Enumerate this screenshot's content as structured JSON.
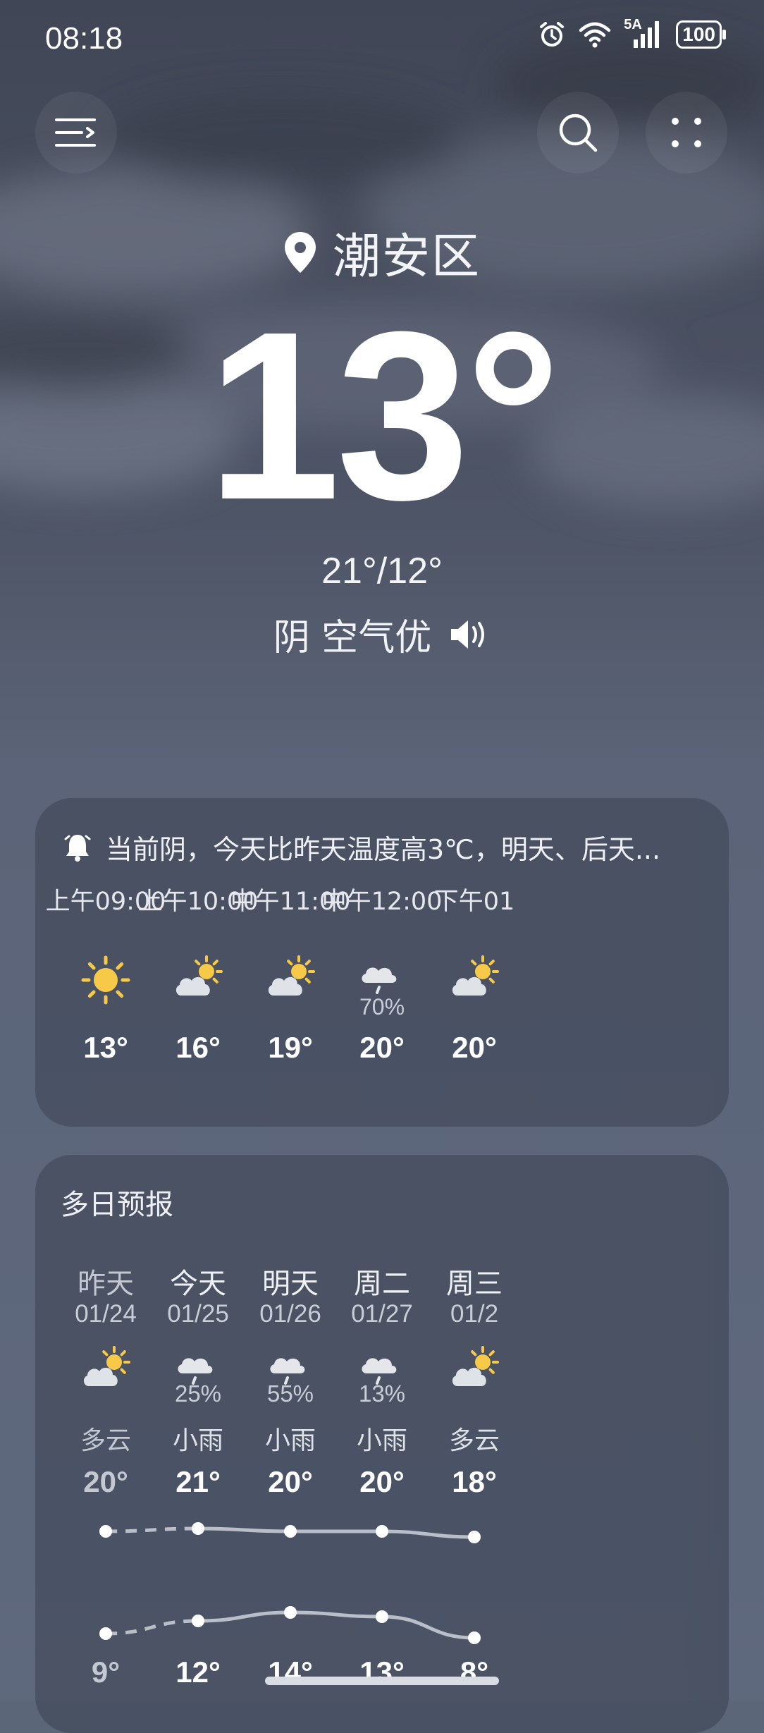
{
  "status_bar": {
    "time": "08:18",
    "network": "5A",
    "battery": "100"
  },
  "location": {
    "name": "潮安区"
  },
  "current": {
    "temp": "13°",
    "range": "21°/12°",
    "condition": "阴 空气优"
  },
  "hourly": {
    "alert": "当前阴，今天比昨天温度高3℃，明天、后天...",
    "hours": [
      {
        "time": "上午09:00",
        "icon": "sun-icon",
        "prob": "",
        "temp": "13°"
      },
      {
        "time": "上午10:00",
        "icon": "partly-cloudy-icon",
        "prob": "",
        "temp": "16°"
      },
      {
        "time": "中午11:00",
        "icon": "partly-cloudy-icon",
        "prob": "",
        "temp": "19°"
      },
      {
        "time": "中午12:00",
        "icon": "light-rain-icon",
        "prob": "70%",
        "temp": "20°"
      },
      {
        "time": "下午01",
        "icon": "partly-cloudy-icon",
        "prob": "",
        "temp": "20°"
      }
    ]
  },
  "daily": {
    "title": "多日预报",
    "days": [
      {
        "name": "昨天",
        "date": "01/24",
        "icon": "partly-cloudy-icon",
        "prob": "",
        "cond": "多云",
        "high": "20°",
        "low": "9°",
        "high_val": 20,
        "low_val": 9
      },
      {
        "name": "今天",
        "date": "01/25",
        "icon": "light-rain-icon",
        "prob": "25%",
        "cond": "小雨",
        "high": "21°",
        "low": "12°",
        "high_val": 21,
        "low_val": 12
      },
      {
        "name": "明天",
        "date": "01/26",
        "icon": "light-rain-icon",
        "prob": "55%",
        "cond": "小雨",
        "high": "20°",
        "low": "14°",
        "high_val": 20,
        "low_val": 14
      },
      {
        "name": "周二",
        "date": "01/27",
        "icon": "light-rain-icon",
        "prob": "13%",
        "cond": "小雨",
        "high": "20°",
        "low": "13°",
        "high_val": 20,
        "low_val": 13
      },
      {
        "name": "周三",
        "date": "01/2",
        "icon": "partly-cloudy-icon",
        "prob": "",
        "cond": "多云",
        "high": "18°",
        "low": "8°",
        "high_val": 18,
        "low_val": 8
      }
    ]
  },
  "colors": {
    "background": "#5c6679",
    "card": "#3a4252",
    "sun": "#f7c948",
    "cloud": "#d8dbe1",
    "line": "#c9cdd6"
  }
}
